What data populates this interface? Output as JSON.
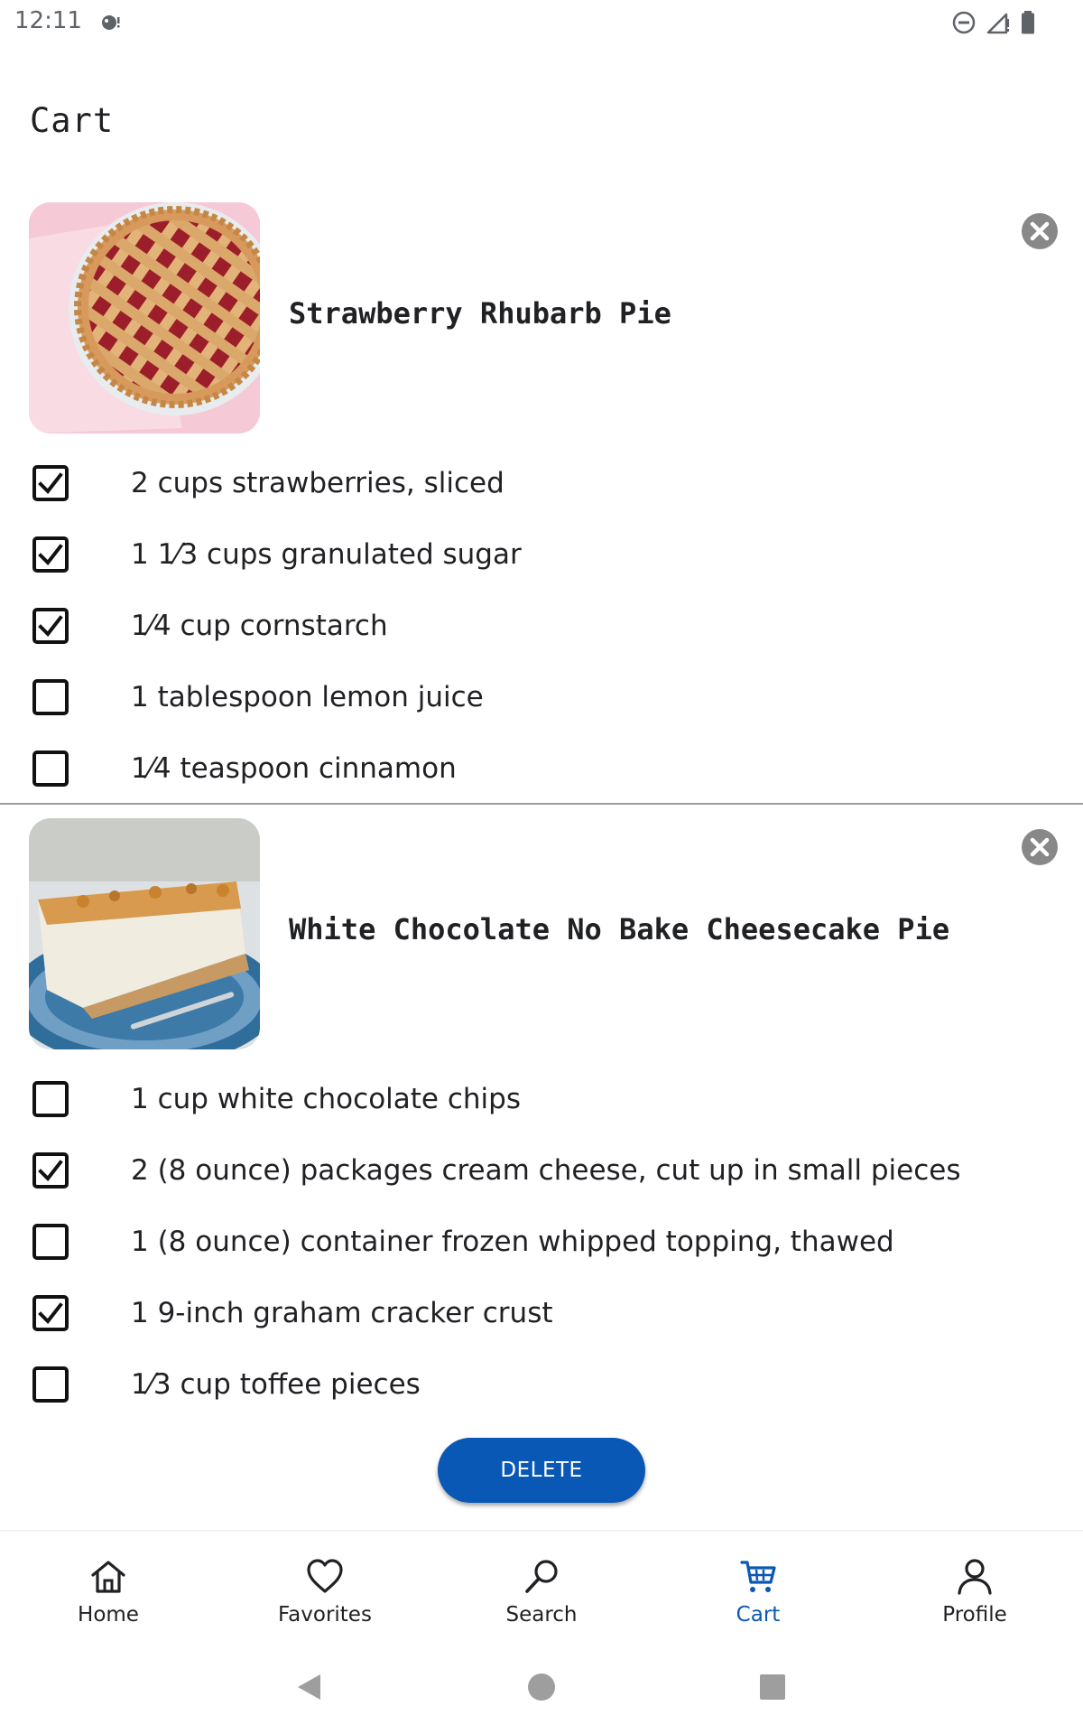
{
  "status_bar": {
    "time": "12:11"
  },
  "page": {
    "title": "Cart"
  },
  "recipes": [
    {
      "title": "Strawberry Rhubarb Pie",
      "ingredients": [
        {
          "text": "2 cups strawberries, sliced",
          "checked": true
        },
        {
          "text": "1 1⁄3 cups granulated sugar",
          "checked": true
        },
        {
          "text": "1⁄4 cup cornstarch",
          "checked": true
        },
        {
          "text": "1 tablespoon lemon juice",
          "checked": false
        },
        {
          "text": "1⁄4 teaspoon cinnamon",
          "checked": false
        }
      ]
    },
    {
      "title": "White Chocolate No Bake Cheesecake Pie",
      "ingredients": [
        {
          "text": "1 cup white chocolate chips",
          "checked": false
        },
        {
          "text": "2 (8 ounce) packages cream cheese, cut up in small pieces",
          "checked": true
        },
        {
          "text": "1 (8 ounce) container frozen whipped topping, thawed",
          "checked": false
        },
        {
          "text": "1 9-inch graham cracker crust",
          "checked": true
        },
        {
          "text": "1⁄3 cup toffee pieces",
          "checked": false
        }
      ]
    }
  ],
  "actions": {
    "delete_label": "DELETE"
  },
  "bottom_nav": {
    "items": [
      {
        "label": "Home",
        "icon": "home-icon",
        "active": false
      },
      {
        "label": "Favorites",
        "icon": "heart-icon",
        "active": false
      },
      {
        "label": "Search",
        "icon": "search-icon",
        "active": false
      },
      {
        "label": "Cart",
        "icon": "cart-icon",
        "active": true
      },
      {
        "label": "Profile",
        "icon": "profile-icon",
        "active": false
      }
    ]
  },
  "colors": {
    "accent": "#0a58b5",
    "text": "#202124",
    "divider": "#9e9e9e"
  }
}
